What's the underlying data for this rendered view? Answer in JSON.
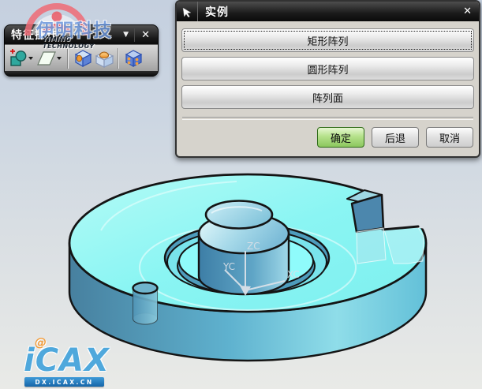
{
  "toolbar": {
    "title": "特征操作",
    "collapse_glyph": "▼",
    "close_glyph": "✕",
    "icons": [
      {
        "name": "unite-icon",
        "has_dropdown": true
      },
      {
        "name": "datum-plane-icon",
        "has_dropdown": true
      },
      {
        "name": "hole-icon",
        "has_dropdown": false
      },
      {
        "name": "boss-icon",
        "has_dropdown": false
      },
      {
        "name": "instance-feature-icon",
        "has_dropdown": false
      }
    ]
  },
  "dialog": {
    "title": "实例",
    "close_glyph": "✕",
    "array_buttons": [
      "矩形阵列",
      "圆形阵列",
      "阵列面"
    ],
    "ok": "确定",
    "back": "后退",
    "cancel": "取消"
  },
  "viewport": {
    "axis_labels": {
      "z": "ZC",
      "y": "YC",
      "x": "XC"
    }
  },
  "watermarks": {
    "top": {
      "cn": "伊明科技",
      "en": "YIMING TECHNOLOGY"
    },
    "bottom": {
      "logo": "iCAX",
      "site": "DX.ICAX.CN"
    }
  },
  "colors": {
    "model_top": "#85f6f6",
    "model_side": "#5aa6c6",
    "outline": "#141414",
    "ok_green": "#8cc75e",
    "accent_red": "#ee6b76",
    "accent_blue": "#47a5dc"
  }
}
